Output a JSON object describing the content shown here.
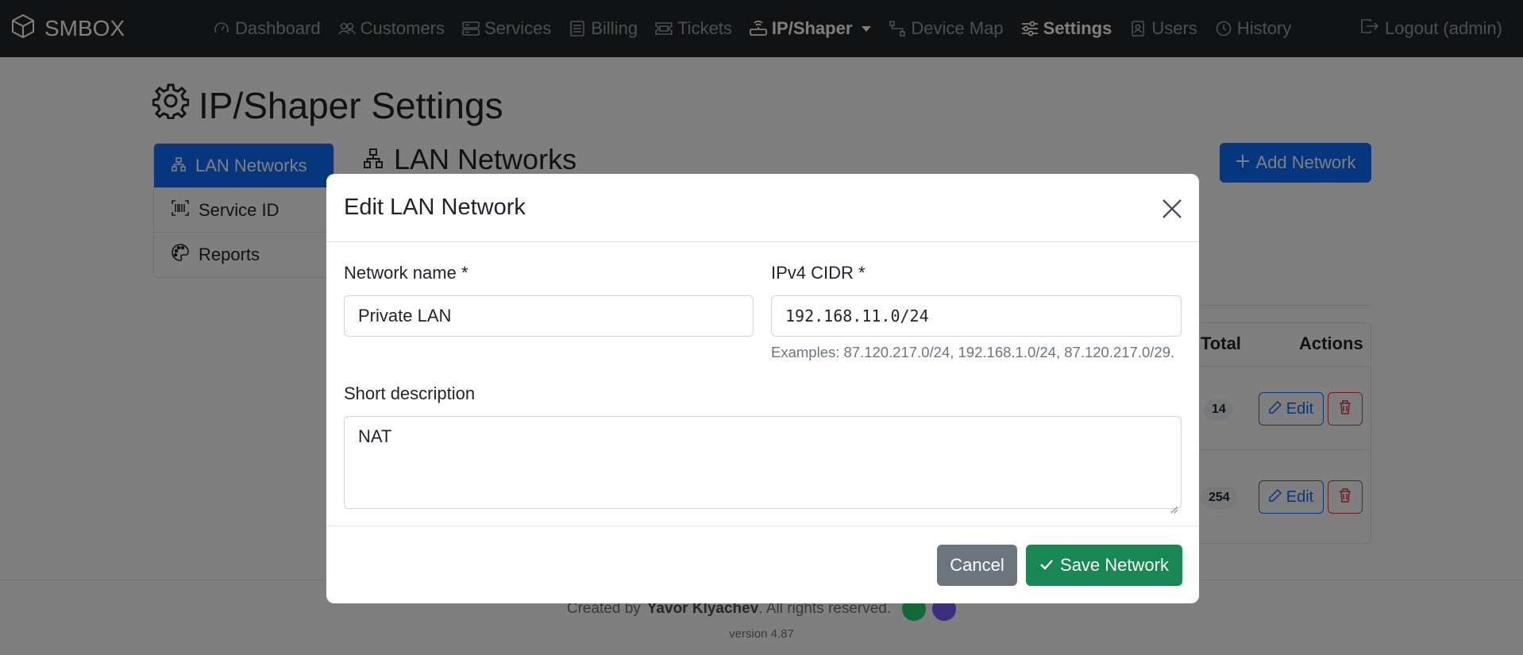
{
  "brand": {
    "name": "SMBOX",
    "icon": "box-icon"
  },
  "nav": {
    "items": [
      {
        "label": "Dashboard",
        "icon": "speedometer-icon"
      },
      {
        "label": "Customers",
        "icon": "people-icon"
      },
      {
        "label": "Services",
        "icon": "server-icon"
      },
      {
        "label": "Billing",
        "icon": "receipt-icon"
      },
      {
        "label": "Tickets",
        "icon": "ticket-icon"
      },
      {
        "label": "IP/Shaper",
        "icon": "router-icon",
        "active": true,
        "dropdown": true
      },
      {
        "label": "Device Map",
        "icon": "diagram-icon"
      },
      {
        "label": "Settings",
        "icon": "sliders-icon",
        "active": true
      },
      {
        "label": "Users",
        "icon": "person-badge-icon"
      },
      {
        "label": "History",
        "icon": "clock-icon"
      }
    ],
    "logout": "Logout (admin)"
  },
  "page": {
    "title": "IP/Shaper Settings",
    "sidebar": [
      {
        "label": "LAN Networks",
        "icon": "diagram-icon",
        "active": true
      },
      {
        "label": "Service ID",
        "icon": "barcode-icon"
      },
      {
        "label": "Reports",
        "icon": "palette-icon"
      }
    ],
    "section_title": "LAN Networks",
    "add_button": "Add Network",
    "table": {
      "headers": {
        "total": "Total",
        "actions": "Actions"
      },
      "rows": [
        {
          "total": "14",
          "edit": "Edit"
        },
        {
          "total": "254",
          "edit": "Edit"
        }
      ]
    }
  },
  "footer": {
    "prefix": "Created by",
    "author": "Yavor Klyachev",
    "suffix": ". All rights reserved.",
    "version": "version 4.87"
  },
  "modal": {
    "title": "Edit LAN Network",
    "name_label": "Network name *",
    "name_value": "Private LAN",
    "cidr_label": "IPv4 CIDR *",
    "cidr_value": "192.168.11.0/24",
    "cidr_help": "Examples: 87.120.217.0/24, 192.168.1.0/24, 87.120.217.0/29.",
    "desc_label": "Short description",
    "desc_value": "NAT",
    "cancel": "Cancel",
    "save": "Save Network"
  },
  "colors": {
    "primary": "#0d6efd",
    "success": "#198754",
    "secondary": "#6c757d",
    "danger": "#dc3545",
    "navbar": "#212529",
    "whatsapp": "#25d366",
    "viber": "#7360f2"
  }
}
